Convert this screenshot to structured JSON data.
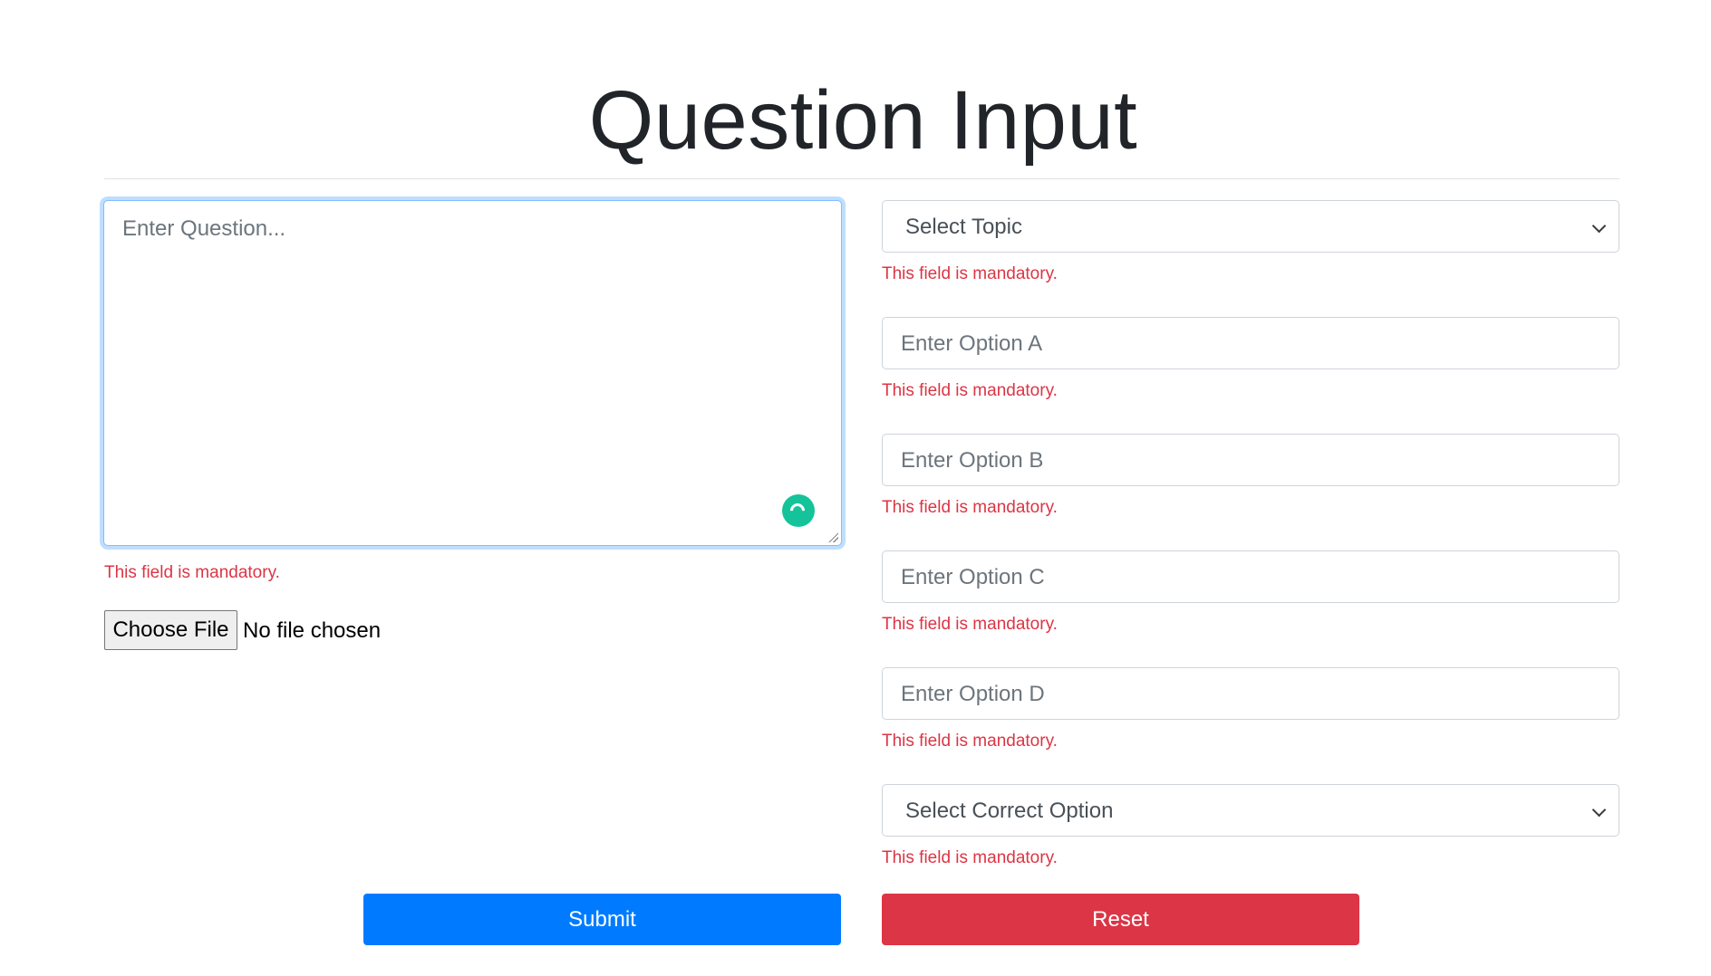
{
  "page": {
    "title": "Question Input"
  },
  "question": {
    "placeholder": "Enter Question...",
    "error": "This field is mandatory."
  },
  "file_input": {
    "button_label": "Choose File",
    "status": "No file chosen"
  },
  "fields": {
    "topic": {
      "placeholder": "Select Topic",
      "error": "This field is mandatory."
    },
    "option_a": {
      "placeholder": "Enter Option A",
      "error": "This field is mandatory."
    },
    "option_b": {
      "placeholder": "Enter Option B",
      "error": "This field is mandatory."
    },
    "option_c": {
      "placeholder": "Enter Option C",
      "error": "This field is mandatory."
    },
    "option_d": {
      "placeholder": "Enter Option D",
      "error": "This field is mandatory."
    },
    "correct_option": {
      "placeholder": "Select Correct Option",
      "error": "This field is mandatory."
    }
  },
  "actions": {
    "submit_label": "Submit",
    "reset_label": "Reset"
  },
  "colors": {
    "primary": "#007bff",
    "danger": "#dc3545",
    "grammar_assistant": "#15c39a"
  }
}
